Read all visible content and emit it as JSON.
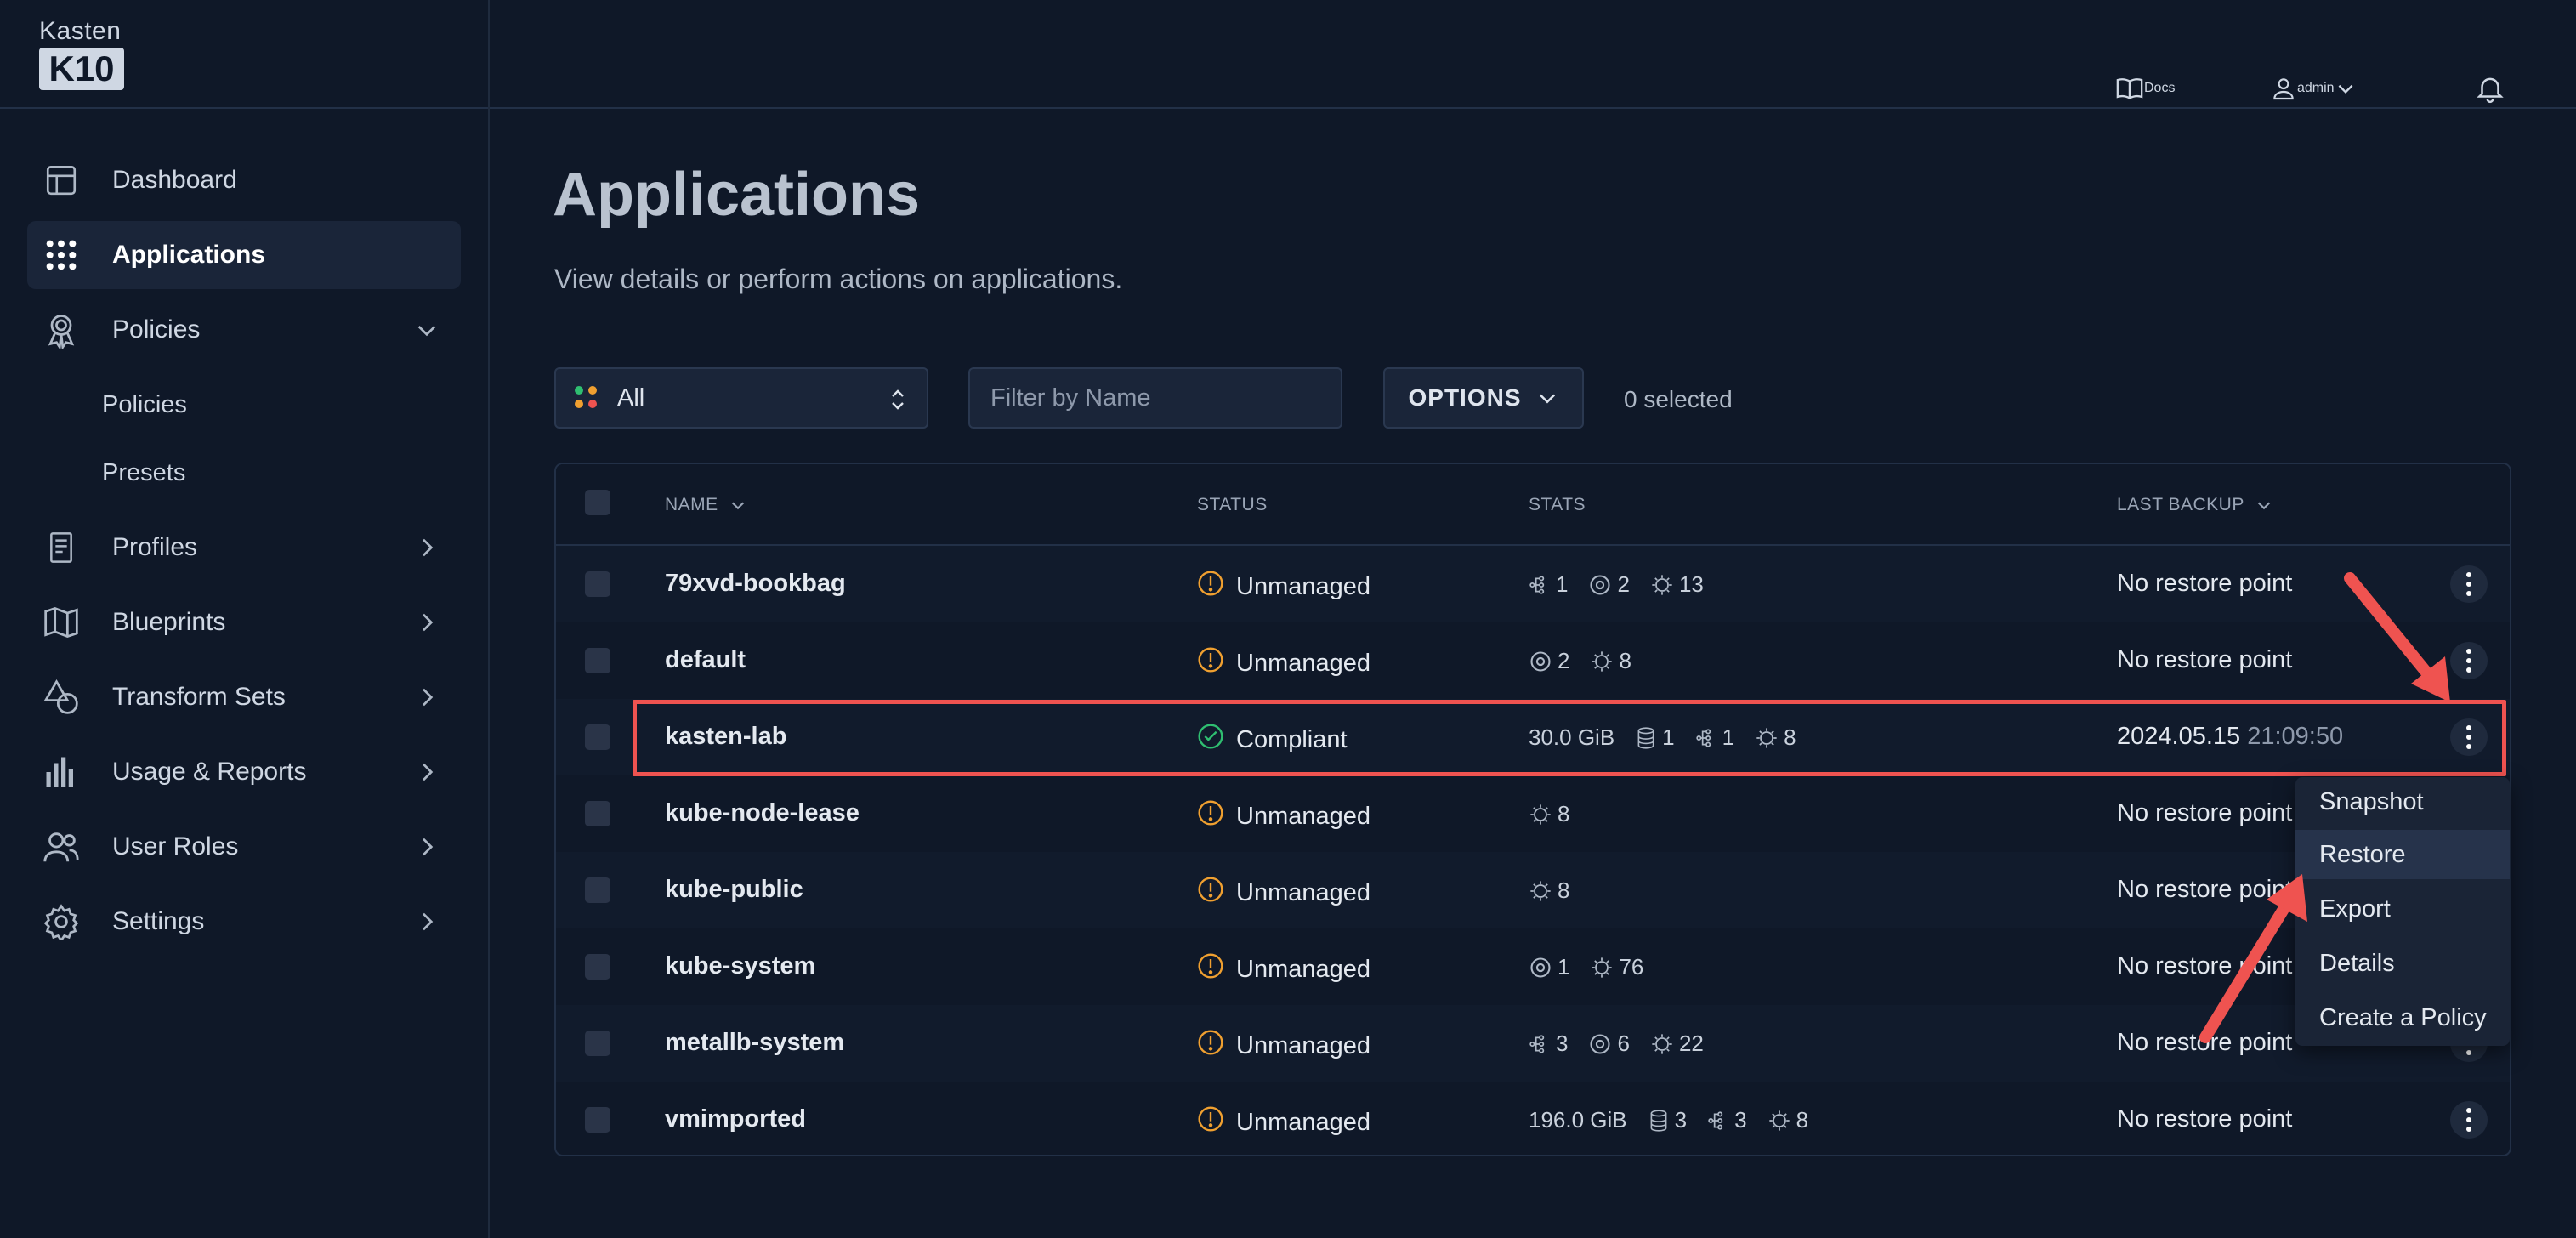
{
  "brand": {
    "line1": "Kasten",
    "line2": "K10"
  },
  "topnav": {
    "docs": "Docs",
    "user": "admin"
  },
  "sidebar": {
    "items": [
      {
        "label": "Dashboard"
      },
      {
        "label": "Applications"
      },
      {
        "label": "Policies"
      },
      {
        "label": "Profiles"
      },
      {
        "label": "Blueprints"
      },
      {
        "label": "Transform Sets"
      },
      {
        "label": "Usage & Reports"
      },
      {
        "label": "User Roles"
      },
      {
        "label": "Settings"
      }
    ],
    "policies_sub": [
      "Policies",
      "Presets"
    ]
  },
  "page": {
    "title": "Applications",
    "subtitle": "View details or perform actions on applications."
  },
  "filters": {
    "scope": "All",
    "name_placeholder": "Filter by Name",
    "options_label": "OPTIONS",
    "selected": "0 selected"
  },
  "table": {
    "columns": {
      "name": "NAME",
      "status": "STATUS",
      "stats": "STATS",
      "last_backup": "LAST BACKUP"
    },
    "rows": [
      {
        "name": "79xvd-bookbag",
        "status": "Unmanaged",
        "stats": [
          {
            "icon": "workload-icon",
            "v": "1"
          },
          {
            "icon": "config-icon",
            "v": "2"
          },
          {
            "icon": "resource-icon",
            "v": "13"
          }
        ],
        "backup": "No restore point",
        "backup_time": ""
      },
      {
        "name": "default",
        "status": "Unmanaged",
        "stats": [
          {
            "icon": "config-icon",
            "v": "2"
          },
          {
            "icon": "resource-icon",
            "v": "8"
          }
        ],
        "backup": "No restore point",
        "backup_time": ""
      },
      {
        "name": "kasten-lab",
        "status": "Compliant",
        "stats": [
          {
            "icon": "size",
            "v": "30.0 GiB"
          },
          {
            "icon": "volume-icon",
            "v": "1"
          },
          {
            "icon": "workload-icon",
            "v": "1"
          },
          {
            "icon": "resource-icon",
            "v": "8"
          }
        ],
        "backup": "2024.05.15",
        "backup_time": "21:09:50"
      },
      {
        "name": "kube-node-lease",
        "status": "Unmanaged",
        "stats": [
          {
            "icon": "resource-icon",
            "v": "8"
          }
        ],
        "backup": "No restore point",
        "backup_time": ""
      },
      {
        "name": "kube-public",
        "status": "Unmanaged",
        "stats": [
          {
            "icon": "resource-icon",
            "v": "8"
          }
        ],
        "backup": "No restore point",
        "backup_time": ""
      },
      {
        "name": "kube-system",
        "status": "Unmanaged",
        "stats": [
          {
            "icon": "config-icon",
            "v": "1"
          },
          {
            "icon": "resource-icon",
            "v": "76"
          }
        ],
        "backup": "No restore point",
        "backup_time": ""
      },
      {
        "name": "metallb-system",
        "status": "Unmanaged",
        "stats": [
          {
            "icon": "workload-icon",
            "v": "3"
          },
          {
            "icon": "config-icon",
            "v": "6"
          },
          {
            "icon": "resource-icon",
            "v": "22"
          }
        ],
        "backup": "No restore point",
        "backup_time": ""
      },
      {
        "name": "vmimported",
        "status": "Unmanaged",
        "stats": [
          {
            "icon": "size",
            "v": "196.0 GiB"
          },
          {
            "icon": "volume-icon",
            "v": "3"
          },
          {
            "icon": "workload-icon",
            "v": "3"
          },
          {
            "icon": "resource-icon",
            "v": "8"
          }
        ],
        "backup": "No restore point",
        "backup_time": ""
      }
    ]
  },
  "menu": {
    "items": [
      "Snapshot",
      "Restore",
      "Export",
      "Details",
      "Create a Policy"
    ]
  },
  "colors": {
    "accent_red": "#ef5350",
    "warning": "#f0a030",
    "ok": "#2fbf71"
  }
}
